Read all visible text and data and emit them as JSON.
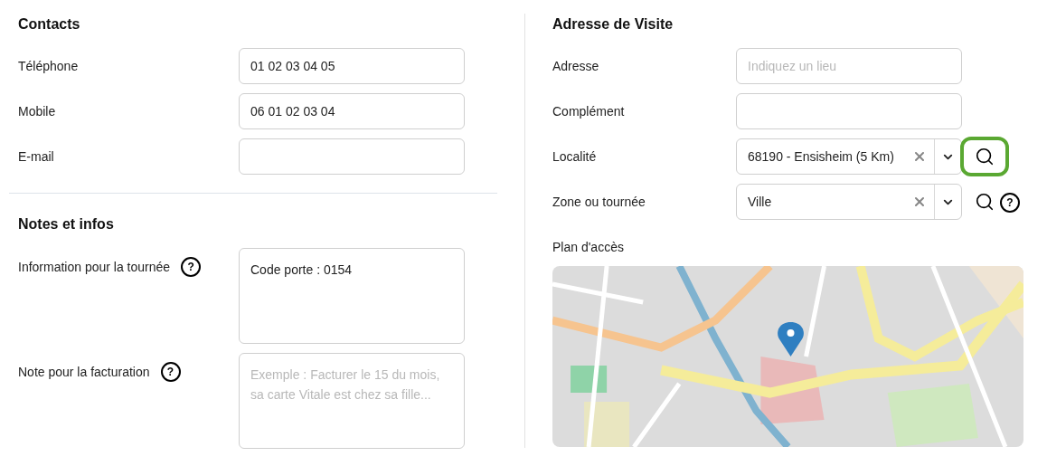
{
  "contacts": {
    "title": "Contacts",
    "fields": [
      {
        "label": "Téléphone",
        "value": "01 02 03 04 05"
      },
      {
        "label": "Mobile",
        "value": "06 01 02 03 04"
      },
      {
        "label": "E-mail"
      }
    ]
  },
  "notes": {
    "title": "Notes et infos",
    "fields": [
      {
        "label": "Information pour la tournée",
        "value": "Code porte : 0154",
        "help": "?"
      },
      {
        "label": "Note pour la facturation",
        "placeholder": "Exemple : Facturer le 15 du mois, sa carte Vitale est chez sa fille...",
        "help": "?"
      }
    ]
  },
  "address": {
    "title": "Adresse de Visite",
    "fields": [
      {
        "kind": "input",
        "label": "Adresse",
        "placeholder": "Indiquez un lieu"
      },
      {
        "kind": "input",
        "label": "Complément"
      },
      {
        "kind": "select",
        "label": "Localité",
        "value": "68190 - Ensisheim (5 Km)",
        "highlighted": true
      },
      {
        "kind": "select",
        "label": "Zone ou tournée",
        "value": "Ville",
        "highlighted": false,
        "help": "?"
      }
    ],
    "map": {
      "label": "Plan d'accès",
      "kind": "picture"
    }
  }
}
